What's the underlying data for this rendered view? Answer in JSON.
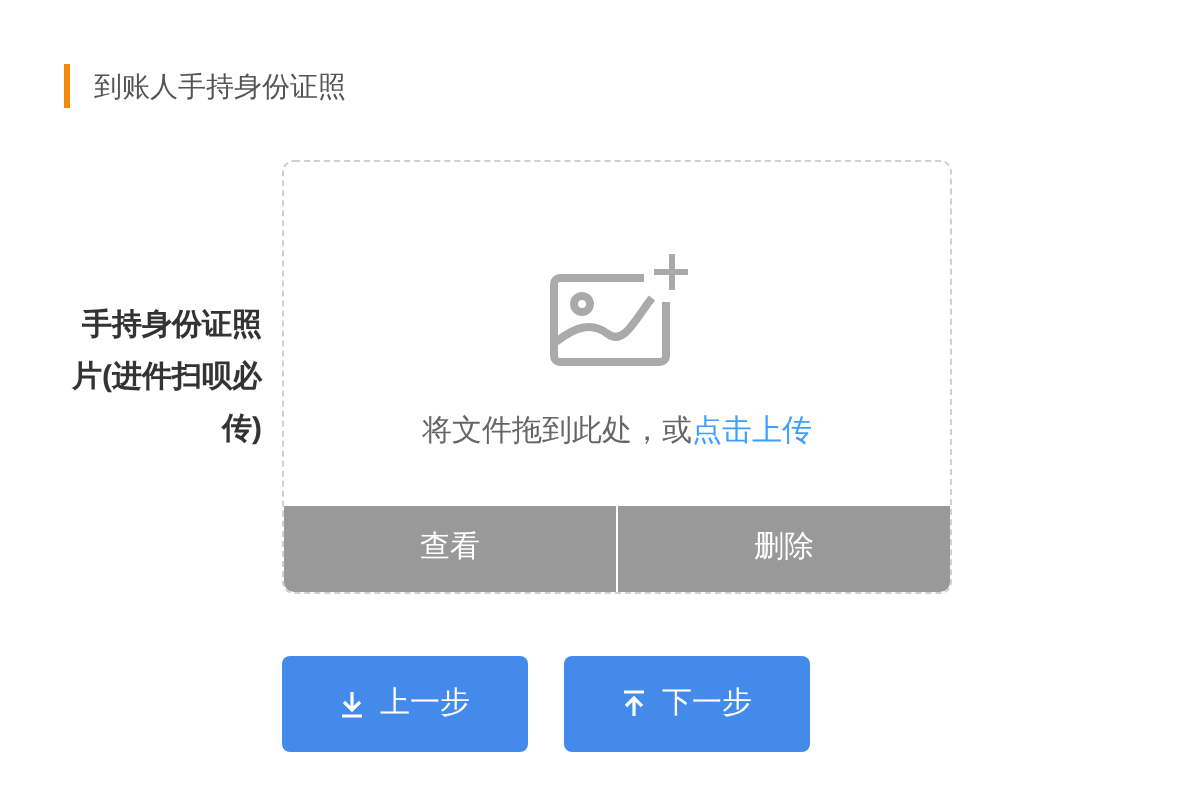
{
  "section_title": "到账人手持身份证照",
  "field": {
    "label": "手持身份证照片(进件扫呗必传)",
    "hint": "将文件拖到此处，或",
    "hint_link": "点击上传",
    "actions": [
      "查看",
      "删除"
    ]
  },
  "buttons": [
    {
      "label": "上一步",
      "kind": "down"
    },
    {
      "label": "下一步",
      "kind": "up"
    }
  ]
}
